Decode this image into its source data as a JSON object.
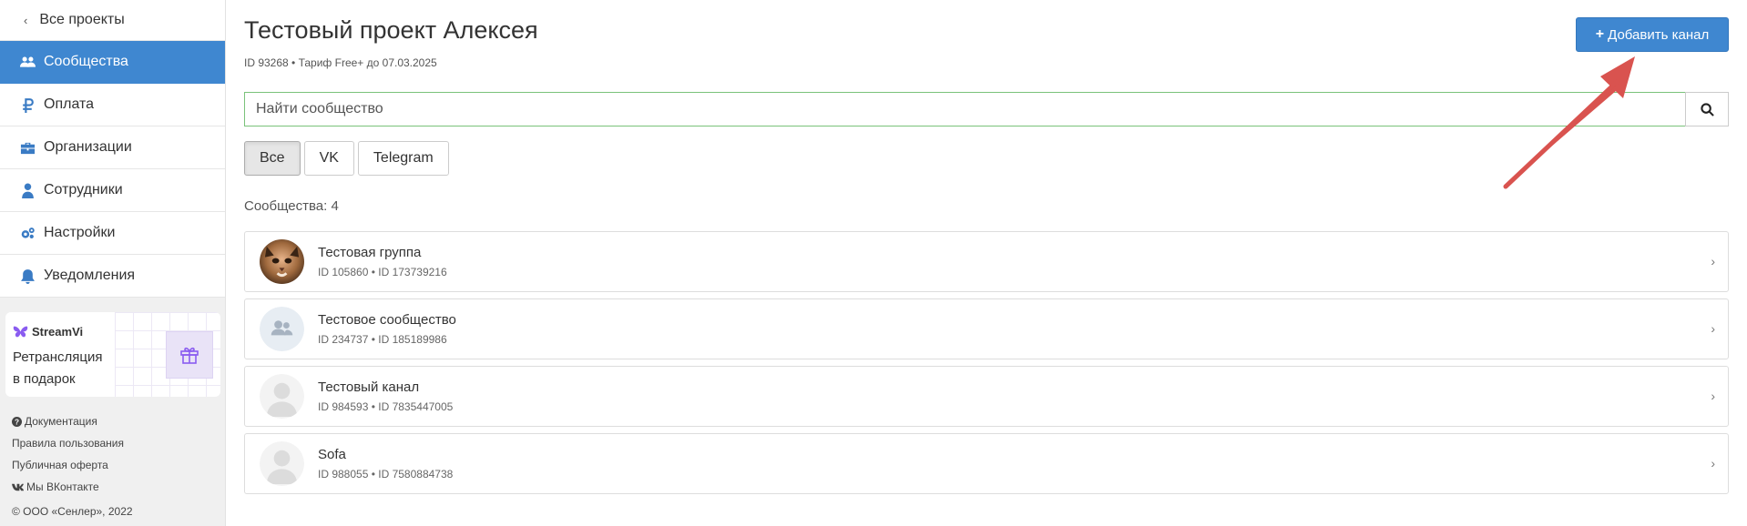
{
  "sidebar": {
    "back_label": "Все проекты",
    "items": [
      {
        "label": "Сообщества",
        "icon": "users-icon",
        "active": true
      },
      {
        "label": "Оплата",
        "icon": "ruble-icon",
        "active": false
      },
      {
        "label": "Организации",
        "icon": "briefcase-icon",
        "active": false
      },
      {
        "label": "Сотрудники",
        "icon": "user-icon",
        "active": false
      },
      {
        "label": "Настройки",
        "icon": "gears-icon",
        "active": false
      },
      {
        "label": "Уведомления",
        "icon": "bell-icon",
        "active": false
      }
    ],
    "promo": {
      "brand": "StreamVi",
      "line1": "Ретрансляция",
      "line2": "в подарок"
    },
    "footer": {
      "docs": "Документация",
      "rules": "Правила пользования",
      "offer": "Публичная оферта",
      "vk": "Мы ВКонтакте",
      "copyright": "© ООО «Сенлер», 2022"
    }
  },
  "header": {
    "title": "Тестовый проект Алексея",
    "meta": "ID 93268 • Тариф Free+ до 07.03.2025",
    "add_button": "Добавить канал"
  },
  "search": {
    "placeholder": "Найти сообщество"
  },
  "filters": [
    {
      "label": "Все",
      "active": true
    },
    {
      "label": "VK",
      "active": false
    },
    {
      "label": "Telegram",
      "active": false
    }
  ],
  "count_label": "Сообщества: 4",
  "communities": [
    {
      "name": "Тестовая группа",
      "ids": "ID 105860 • ID 173739216",
      "avatar": "photo"
    },
    {
      "name": "Тестовое сообщество",
      "ids": "ID 234737 • ID 185189986",
      "avatar": "group"
    },
    {
      "name": "Тестовый канал",
      "ids": "ID 984593 • ID 7835447005",
      "avatar": "person"
    },
    {
      "name": "Sofa",
      "ids": "ID 988055 • ID 7580884738",
      "avatar": "person"
    }
  ],
  "colors": {
    "accent": "#3f87d0",
    "annotation_arrow": "#d9534f",
    "search_border": "#7ac27a"
  }
}
